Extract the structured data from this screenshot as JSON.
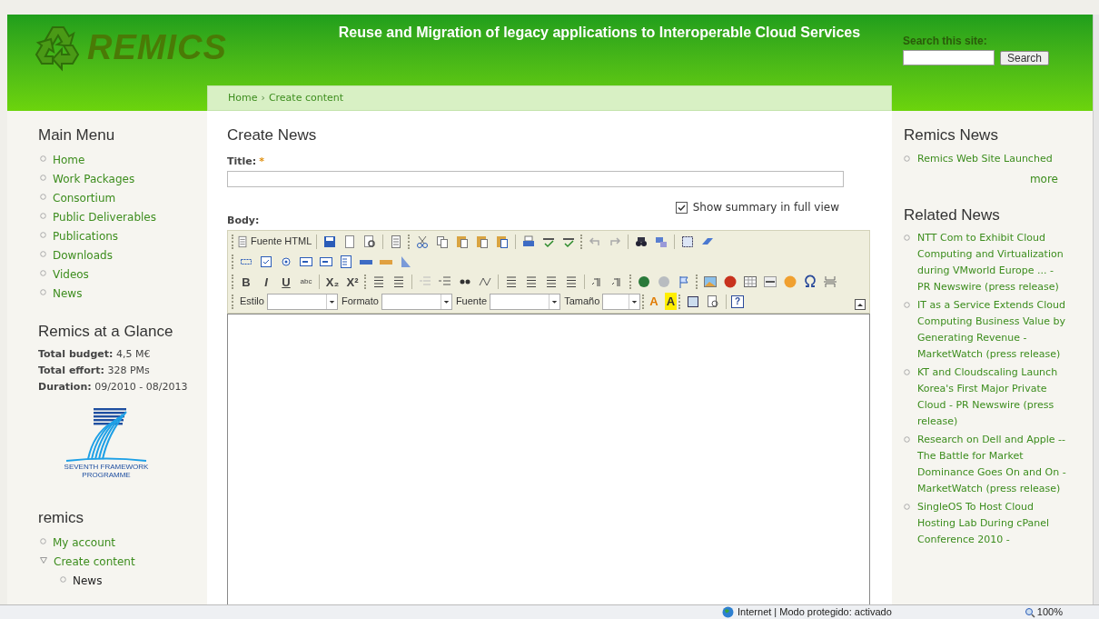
{
  "header": {
    "logo_text": "REMICS",
    "tagline": "Reuse and Migration of legacy applications to Interoperable Cloud Services",
    "search": {
      "label": "Search this site:",
      "button": "Search"
    }
  },
  "breadcrumb": {
    "separator": "›",
    "items": [
      {
        "label": "Home"
      },
      {
        "label": "Create content"
      }
    ]
  },
  "left_sidebar": {
    "main_menu": {
      "title": "Main Menu",
      "items": [
        {
          "label": "Home"
        },
        {
          "label": "Work Packages"
        },
        {
          "label": "Consortium"
        },
        {
          "label": "Public Deliverables"
        },
        {
          "label": "Publications"
        },
        {
          "label": "Downloads"
        },
        {
          "label": "Videos"
        },
        {
          "label": "News"
        }
      ]
    },
    "glance": {
      "title": "Remics at a Glance",
      "facts": [
        {
          "label": "Total budget:",
          "value": "4,5 M€"
        },
        {
          "label": "Total effort:",
          "value": "328 PMs"
        },
        {
          "label": "Duration:",
          "value": "09/2010 - 08/2013"
        }
      ],
      "logo_caption": [
        "SEVENTH FRAMEWORK",
        "PROGRAMME"
      ]
    },
    "user_menu": {
      "title": "remics",
      "items": [
        {
          "label": "My account",
          "kind": "leaf",
          "active": false
        },
        {
          "label": "Create content",
          "kind": "expanded",
          "active": false,
          "children": [
            {
              "label": "News",
              "kind": "leaf",
              "active": true
            }
          ]
        }
      ]
    }
  },
  "content": {
    "title": "Create News",
    "title_field": {
      "label": "Title:",
      "required_mark": "*"
    },
    "summary_checkbox": {
      "label": "Show summary in full view",
      "checked": true
    },
    "body_label": "Body:",
    "editor": {
      "source_button": "Fuente HTML",
      "format_buttons": [
        "B",
        "I",
        "U",
        "abc",
        "X₂",
        "X²"
      ],
      "selects": [
        "Estilo",
        "Formato",
        "Fuente",
        "Tamaño"
      ],
      "text_color_button": "A",
      "bg_color_button": "A",
      "help_button": "?"
    }
  },
  "right_sidebar": {
    "remics_news": {
      "title": "Remics News",
      "items": [
        "Remics Web Site Launched"
      ],
      "more": "more"
    },
    "related_news": {
      "title": "Related News",
      "items": [
        "NTT Com to Exhibit Cloud Computing and Virtualization during VMworld Europe ... - PR Newswire (press release)",
        "IT as a Service Extends Cloud Computing Business Value by Generating Revenue - MarketWatch (press release)",
        "KT and Cloudscaling Launch Korea's First Major Private Cloud - PR Newswire (press release)",
        "Research on Dell and Apple -- The Battle for Market Dominance Goes On and On - MarketWatch (press release)",
        "SingleOS To Host Cloud Hosting Lab During cPanel Conference 2010 -"
      ]
    }
  },
  "status_bar": {
    "zone": "Internet | Modo protegido: activado",
    "zoom": "100%"
  }
}
